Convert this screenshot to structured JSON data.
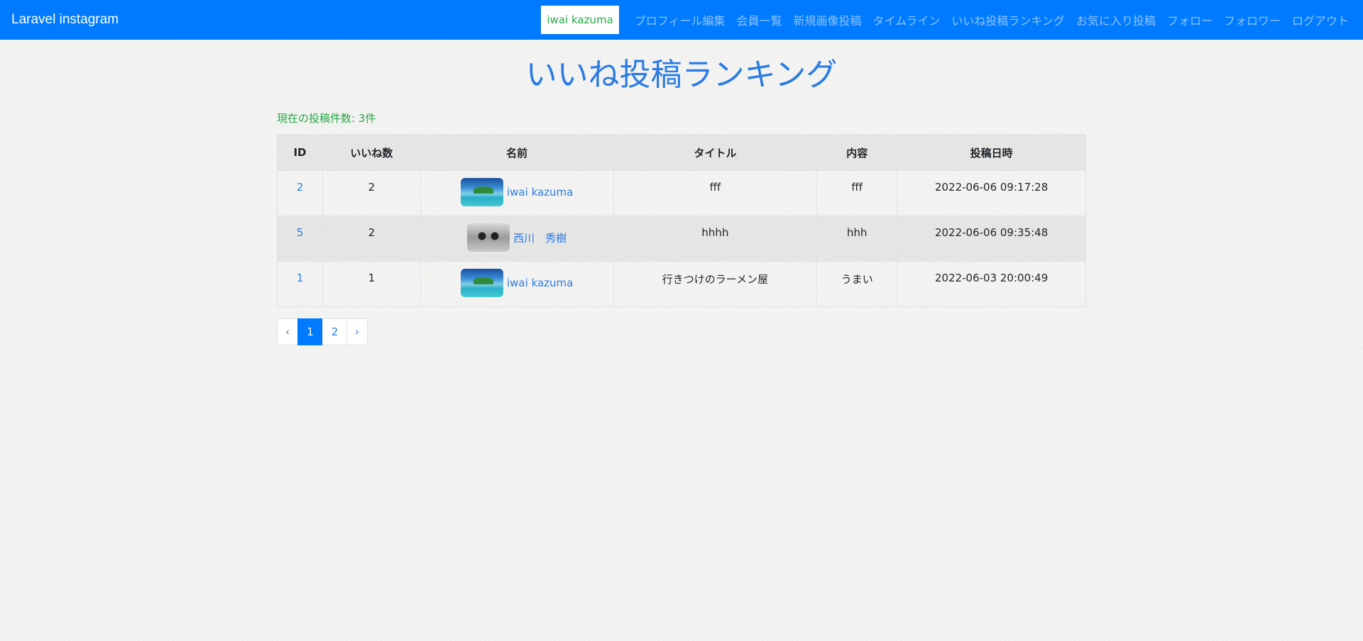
{
  "navbar": {
    "brand": "Laravel instagram",
    "user": "iwai kazuma",
    "links": [
      "プロフィール編集",
      "会員一覧",
      "新規画像投稿",
      "タイムライン",
      "いいね投稿ランキング",
      "お気に入り投稿",
      "フォロー",
      "フォロワー",
      "ログアウト"
    ]
  },
  "main": {
    "title": "いいね投稿ランキング",
    "count_text": "現在の投稿件数: 3件",
    "table": {
      "headers": [
        "ID",
        "いいね数",
        "名前",
        "タイトル",
        "内容",
        "投稿日時"
      ],
      "rows": [
        {
          "id": "2",
          "likes": "2",
          "name": "iwai kazuma",
          "avatar": "beach",
          "title": "fff",
          "content": "fff",
          "date": "2022-06-06 09:17:28"
        },
        {
          "id": "5",
          "likes": "2",
          "name": "西川　秀樹",
          "avatar": "face",
          "title": "hhhh",
          "content": "hhh",
          "date": "2022-06-06 09:35:48"
        },
        {
          "id": "1",
          "likes": "1",
          "name": "iwai kazuma",
          "avatar": "beach",
          "title": "行きつけのラーメン屋",
          "content": "うまい",
          "date": "2022-06-03 20:00:49"
        }
      ]
    },
    "pagination": {
      "prev": "‹",
      "pages": [
        "1",
        "2"
      ],
      "current": "1",
      "next": "›"
    }
  }
}
